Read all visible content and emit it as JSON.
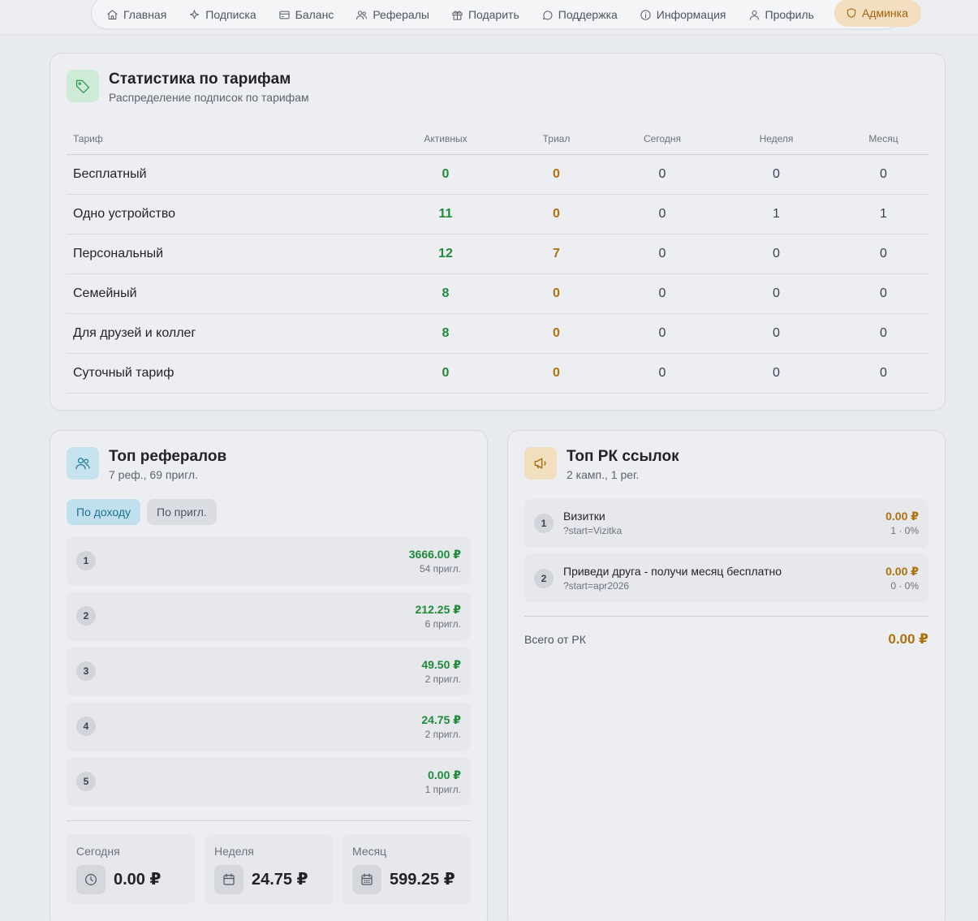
{
  "nav": {
    "items": [
      {
        "label": "Главная",
        "icon": "home-icon"
      },
      {
        "label": "Подписка",
        "icon": "sparkle-icon"
      },
      {
        "label": "Баланс",
        "icon": "wallet-icon"
      },
      {
        "label": "Рефералы",
        "icon": "users-icon"
      },
      {
        "label": "Подарить",
        "icon": "gift-icon"
      },
      {
        "label": "Поддержка",
        "icon": "chat-icon"
      },
      {
        "label": "Информация",
        "icon": "info-icon"
      },
      {
        "label": "Профиль",
        "icon": "user-icon"
      }
    ],
    "admin_label": "Админка"
  },
  "tariffs": {
    "title": "Статистика по тарифам",
    "subtitle": "Распределение подписок по тарифам",
    "columns": [
      "Тариф",
      "Активных",
      "Триал",
      "Сегодня",
      "Неделя",
      "Месяц"
    ],
    "rows": [
      {
        "name": "Бесплатный",
        "active": "0",
        "trial": "0",
        "today": "0",
        "week": "0",
        "month": "0"
      },
      {
        "name": "Одно устройство",
        "active": "11",
        "trial": "0",
        "today": "0",
        "week": "1",
        "month": "1"
      },
      {
        "name": "Персональный",
        "active": "12",
        "trial": "7",
        "today": "0",
        "week": "0",
        "month": "0"
      },
      {
        "name": "Семейный",
        "active": "8",
        "trial": "0",
        "today": "0",
        "week": "0",
        "month": "0"
      },
      {
        "name": "Для друзей и коллег",
        "active": "8",
        "trial": "0",
        "today": "0",
        "week": "0",
        "month": "0"
      },
      {
        "name": "Суточный тариф",
        "active": "0",
        "trial": "0",
        "today": "0",
        "week": "0",
        "month": "0"
      }
    ]
  },
  "referrals": {
    "title": "Топ рефералов",
    "subtitle": "7 реф., 69 пригл.",
    "tab_income": "По доходу",
    "tab_invites": "По пригл.",
    "items": [
      {
        "rank": "1",
        "amount": "3666.00 ₽",
        "invites": "54 пригл."
      },
      {
        "rank": "2",
        "amount": "212.25 ₽",
        "invites": "6 пригл."
      },
      {
        "rank": "3",
        "amount": "49.50 ₽",
        "invites": "2 пригл."
      },
      {
        "rank": "4",
        "amount": "24.75 ₽",
        "invites": "2 пригл."
      },
      {
        "rank": "5",
        "amount": "0.00 ₽",
        "invites": "1 пригл."
      }
    ],
    "periods": [
      {
        "label": "Сегодня",
        "value": "0.00 ₽",
        "icon": "clock-icon"
      },
      {
        "label": "Неделя",
        "value": "24.75 ₽",
        "icon": "calendar-icon"
      },
      {
        "label": "Месяц",
        "value": "599.25 ₽",
        "icon": "calendar-grid-icon"
      }
    ]
  },
  "rk": {
    "title": "Топ РК ссылок",
    "subtitle": "2 камп., 1 рег.",
    "items": [
      {
        "rank": "1",
        "name": "Визитки",
        "code": "?start=Vizitka",
        "amount": "0.00 ₽",
        "stat": "1 · 0%"
      },
      {
        "rank": "2",
        "name": "Приведи друга - получи месяц бесплатно",
        "code": "?start=apr2026",
        "amount": "0.00 ₽",
        "stat": "0 · 0%"
      }
    ],
    "total_label": "Всего от РК",
    "total_value": "0.00 ₽"
  },
  "colors": {
    "green": "#1f8a3a",
    "orange": "#b0700c",
    "admin_bg": "#f3dfbf",
    "tag_badge": "#cdebd6",
    "users_badge": "#c5e3ee",
    "rk_badge": "#f1dfbd"
  }
}
